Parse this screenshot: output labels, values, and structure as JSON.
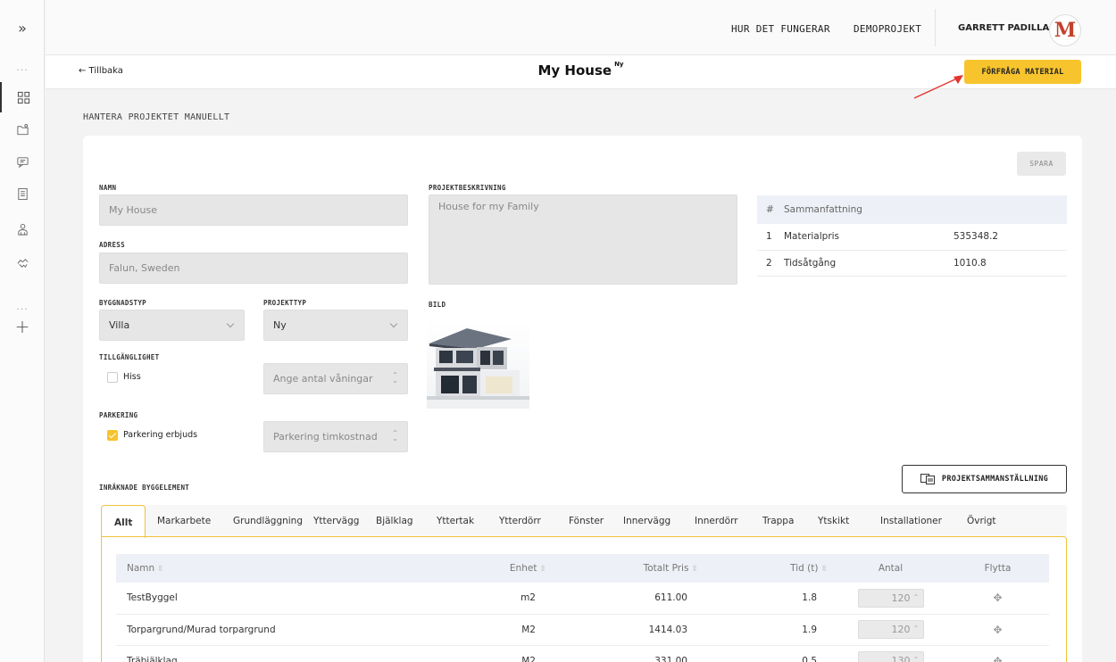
{
  "nav": {
    "how_it_works": "HUR DET FUNGERAR",
    "demo_project": "DEMOPROJEKT",
    "user_name": "GARRETT PADILLA",
    "avatar_letter": "M"
  },
  "header": {
    "back": "← Tillbaka",
    "title": "My House",
    "badge": "Ny",
    "request_button": "FÖRFRÅGA MATERIAL"
  },
  "section_title": "HANTERA PROJEKTET MANUELLT",
  "form": {
    "save": "SPARA",
    "name_label": "NAMN",
    "name_value": "My House",
    "address_label": "ADRESS",
    "address_value": "Falun, Sweden",
    "description_label": "PROJEKTBESKRIVNING",
    "description_value": "House for my Family",
    "building_type_label": "BYGGNADSTYP",
    "building_type_value": "Villa",
    "project_type_label": "PROJEKTTYP",
    "project_type_value": "Ny",
    "image_label": "BILD",
    "accessibility_label": "TILLGÄNGLIGHET",
    "elevator_label": "Hiss",
    "elevator_checked": false,
    "floors_placeholder": "Ange antal våningar",
    "parking_label": "PARKERING",
    "parking_offered_label": "Parkering erbjuds",
    "parking_checked": true,
    "parking_cost_placeholder": "Parkering timkostnad"
  },
  "summary": {
    "col_hash": "#",
    "col_title": "Sammanfattning",
    "rows": [
      {
        "n": "1",
        "label": "Materialpris",
        "value": "535348.2"
      },
      {
        "n": "2",
        "label": "Tidsåtgång",
        "value": "1010.8"
      }
    ]
  },
  "elements": {
    "title": "INRÄKNADE BYGGELEMENT",
    "summary_button": "PROJEKTSAMMANSTÄLLNING",
    "tabs": [
      "Allt",
      "Markarbete",
      "Grundläggning",
      "Yttervägg",
      "Bjälklag",
      "Yttertak",
      "Ytterdörr",
      "Fönster",
      "Innervägg",
      "Innerdörr",
      "Trappa",
      "Ytskikt",
      "Installationer",
      "Övrigt"
    ],
    "active_tab": "Allt",
    "columns": [
      "Namn",
      "Enhet",
      "Totalt Pris",
      "Tid (t)",
      "Antal",
      "Flytta"
    ],
    "rows": [
      {
        "name": "TestByggel",
        "unit": "m2",
        "price": "611.00",
        "time": "1.8",
        "qty": "120"
      },
      {
        "name": "Torpargrund/Murad torpargrund",
        "unit": "M2",
        "price": "1414.03",
        "time": "1.9",
        "qty": "120"
      },
      {
        "name": "Träbjälklag",
        "unit": "M2",
        "price": "331.00",
        "time": "0.5",
        "qty": "130"
      }
    ]
  },
  "colors": {
    "accent": "#f7c42d",
    "input_bg": "#e6e6e6",
    "table_header_bg": "#eef0f7"
  }
}
